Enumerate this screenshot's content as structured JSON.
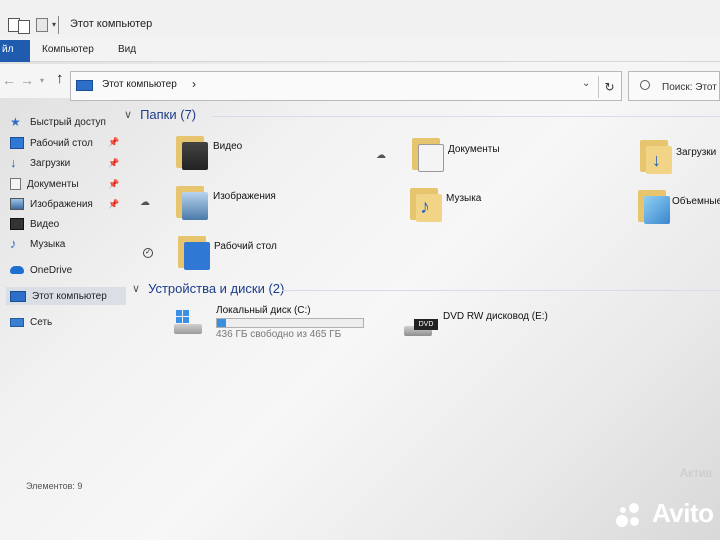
{
  "window": {
    "title": "Этот компьютер"
  },
  "ribbon": {
    "tabs": [
      "Файл",
      "Компьютер",
      "Вид"
    ],
    "file_tab_visible": "йл"
  },
  "address": {
    "location": "Этот компьютер",
    "search_placeholder": "Поиск: Этот к"
  },
  "sidebar": {
    "items": [
      {
        "label": "Быстрый доступ",
        "icon": "star-icon"
      },
      {
        "label": "Рабочий стол",
        "icon": "desktop-icon",
        "pinned": true
      },
      {
        "label": "Загрузки",
        "icon": "download-icon",
        "pinned": true
      },
      {
        "label": "Документы",
        "icon": "documents-icon",
        "pinned": true
      },
      {
        "label": "Изображения",
        "icon": "pictures-icon",
        "pinned": true
      },
      {
        "label": "Видео",
        "icon": "video-icon"
      },
      {
        "label": "Музыка",
        "icon": "music-icon"
      },
      {
        "label": "OneDrive",
        "icon": "onedrive-icon"
      },
      {
        "label": "Этот компьютер",
        "icon": "this-pc-icon",
        "selected": true
      },
      {
        "label": "Сеть",
        "icon": "network-icon"
      }
    ]
  },
  "folders_group": {
    "title": "Папки (7)",
    "items": [
      {
        "label": "Видео",
        "icon": "video-folder-icon"
      },
      {
        "label": "Документы",
        "icon": "documents-folder-icon"
      },
      {
        "label": "Загрузки",
        "icon": "downloads-folder-icon"
      },
      {
        "label": "Изображения",
        "icon": "pictures-folder-icon"
      },
      {
        "label": "Музыка",
        "icon": "music-folder-icon"
      },
      {
        "label": "Объемные",
        "icon": "3d-objects-folder-icon"
      },
      {
        "label": "Рабочий стол",
        "icon": "desktop-folder-icon"
      }
    ]
  },
  "drives_group": {
    "title": "Устройства и диски (2)",
    "drives": [
      {
        "label": "Локальный диск (C:)",
        "free": "436 ГБ свободно из 465 ГБ",
        "used_fraction": 0.062,
        "icon": "hard-drive-icon"
      },
      {
        "label": "DVD RW дисковод (E:)",
        "badge": "DVD",
        "icon": "dvd-drive-icon"
      }
    ]
  },
  "status": {
    "items_count": "Элементов: 9"
  },
  "overlay": {
    "activate_fragment": "Актив",
    "brand": "Avito"
  },
  "colors": {
    "accent": "#1f5cb0",
    "group_header": "#1c3d8a",
    "folder": "#f2d487",
    "drive_fill": "#3c8fe0"
  }
}
